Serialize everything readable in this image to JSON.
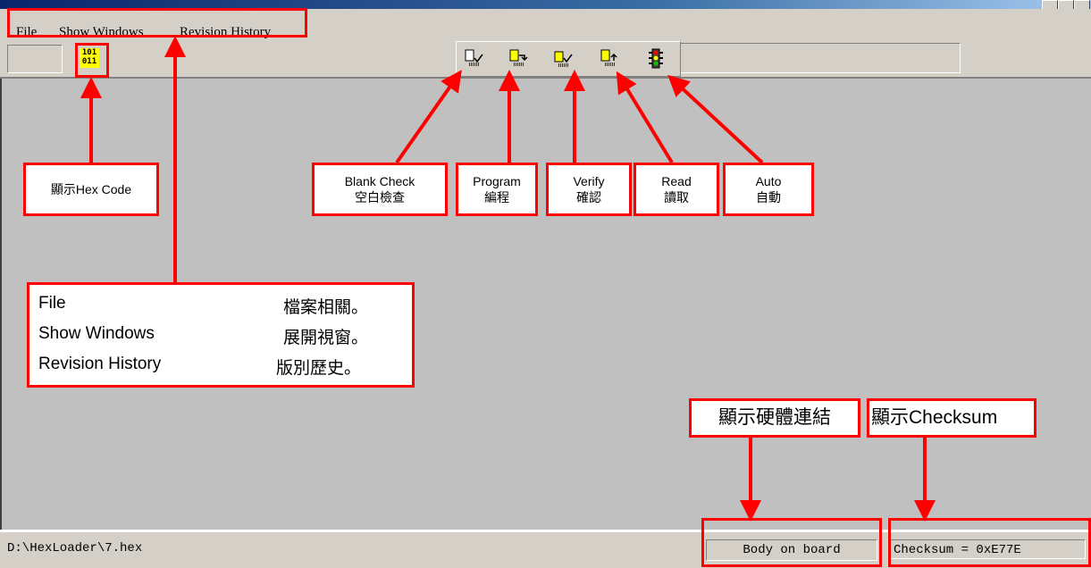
{
  "menu": {
    "items": [
      {
        "label": "File"
      },
      {
        "label": "Show Windows"
      },
      {
        "label": "Revision History"
      }
    ]
  },
  "toolbar": {
    "hex_icon_text": [
      "101",
      "011"
    ],
    "buttons": [
      {
        "name": "blank-check",
        "icon": "blank-check-icon"
      },
      {
        "name": "program",
        "icon": "program-icon"
      },
      {
        "name": "verify",
        "icon": "verify-icon"
      },
      {
        "name": "read",
        "icon": "read-icon"
      },
      {
        "name": "auto",
        "icon": "traffic-light-icon"
      }
    ]
  },
  "status": {
    "path": "D:\\HexLoader\\7.hex",
    "connection": "Body on board",
    "checksum": "Checksum = 0xE77E"
  },
  "annotations": {
    "hex_code": "顯示Hex Code",
    "blank_check": {
      "en": "Blank Check",
      "zh": "空白檢查"
    },
    "program": {
      "en": "Program",
      "zh": "編程"
    },
    "verify": {
      "en": "Verify",
      "zh": "確認"
    },
    "read": {
      "en": "Read",
      "zh": "讀取"
    },
    "auto": {
      "en": "Auto",
      "zh": "自動"
    },
    "menu_legend": [
      {
        "en": "File",
        "zh": "檔案相關。"
      },
      {
        "en": "Show Windows",
        "zh": "展開視窗。"
      },
      {
        "en": "Revision History",
        "zh": "版別歷史。"
      }
    ],
    "hardware_link": "顯示硬體連結",
    "checksum": "顯示Checksum"
  },
  "colors": {
    "annotation": "#ff0000",
    "window_face": "#d4d0c8",
    "client_area": "#c0c0c0"
  }
}
